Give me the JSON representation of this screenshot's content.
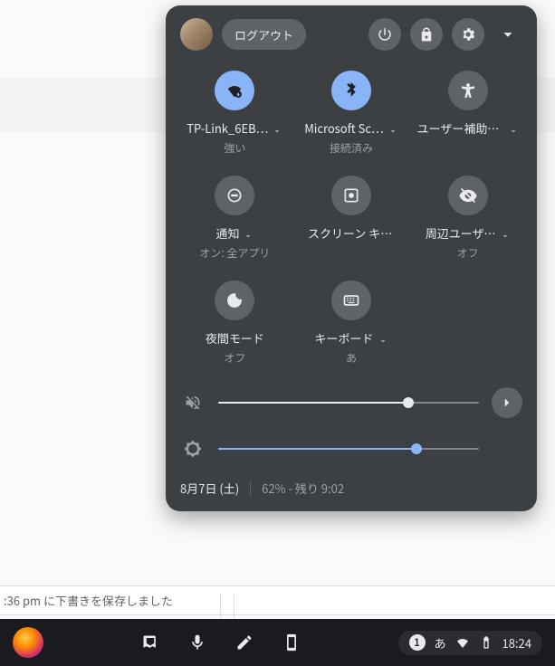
{
  "background": {
    "save_line": ":36 pm に下書きを保存しました"
  },
  "panel": {
    "logout_label": "ログアウト",
    "tiles": [
      {
        "id": "wifi",
        "label": "TP-Link_6EB…",
        "sub": "強い",
        "on": true,
        "arrow": true
      },
      {
        "id": "bluetooth",
        "label": "Microsoft Sc…",
        "sub": "接続済み",
        "on": true,
        "arrow": true
      },
      {
        "id": "accessibility",
        "label": "ユーザー補助機能",
        "sub": "",
        "on": false,
        "arrow": true
      },
      {
        "id": "notifications",
        "label": "通知",
        "sub": "オン: 全アプリ",
        "on": false,
        "arrow": true
      },
      {
        "id": "screencap",
        "label": "スクリーン キャプチャ",
        "sub": "",
        "on": false,
        "arrow": false
      },
      {
        "id": "nearby",
        "label": "周辺ユーザ…",
        "sub": "オフ",
        "on": false,
        "arrow": true
      },
      {
        "id": "nightlight",
        "label": "夜間モード",
        "sub": "オフ",
        "on": false,
        "arrow": false
      },
      {
        "id": "keyboard",
        "label": "キーボード",
        "sub": "あ",
        "on": false,
        "arrow": true
      }
    ],
    "volume_percent": 73,
    "brightness_percent": 76,
    "date": "8月7日 (土)",
    "battery": "62% - 残り 9:02"
  },
  "shelf": {
    "notif_count": "1",
    "ime": "あ",
    "time": "18:24"
  }
}
